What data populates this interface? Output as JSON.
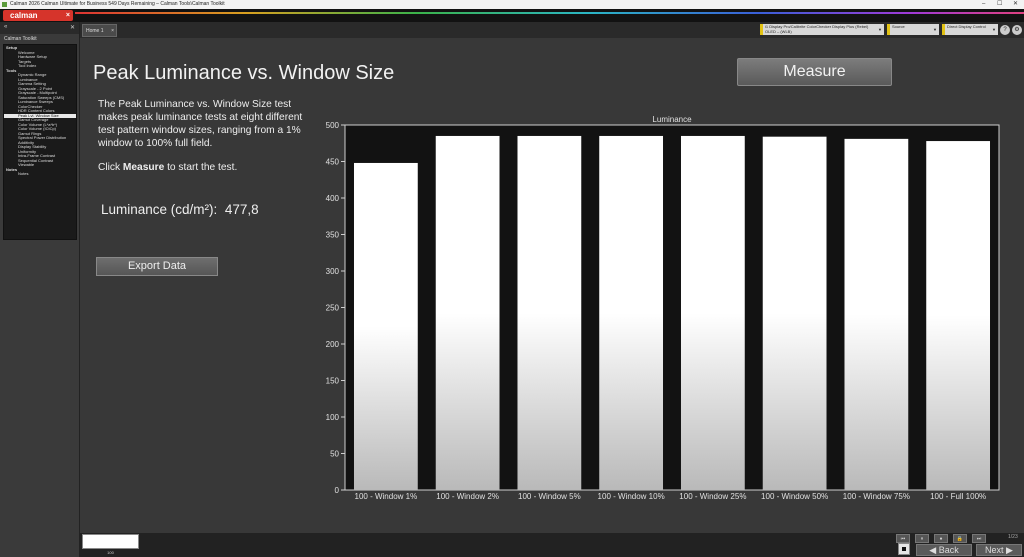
{
  "window": {
    "title": "Calman 2026 Calman Ultimate for Business 549 Days Remaining – Calman Tools\\Calman Toolkit",
    "minimize": "–",
    "maximize": "☐",
    "close": "✕"
  },
  "brand": {
    "logo": "calman",
    "close": "×"
  },
  "sidebar": {
    "title": "Calman Toolkit",
    "collapse": "«",
    "pin": "✕",
    "items": [
      {
        "label": "Setup",
        "kind": "section"
      },
      {
        "label": "Welcome",
        "kind": "leaf"
      },
      {
        "label": "Hardware Setup",
        "kind": "leaf"
      },
      {
        "label": "Targets",
        "kind": "leaf"
      },
      {
        "label": "Tool Index",
        "kind": "leaf"
      },
      {
        "label": "Tools",
        "kind": "section"
      },
      {
        "label": "Dynamic Range",
        "kind": "leaf"
      },
      {
        "label": "Luminance",
        "kind": "leaf"
      },
      {
        "label": "Gamma Setting",
        "kind": "leaf"
      },
      {
        "label": "Grayscale - 2 Point",
        "kind": "leaf"
      },
      {
        "label": "Grayscale - Multipoint",
        "kind": "leaf"
      },
      {
        "label": "Saturation Sweeps (CMS)",
        "kind": "leaf"
      },
      {
        "label": "Luminance Sweeps",
        "kind": "leaf"
      },
      {
        "label": "ColorChecker",
        "kind": "leaf"
      },
      {
        "label": "HDR Content Colors",
        "kind": "leaf"
      },
      {
        "label": "Peak Lvl. Window Size",
        "kind": "leaf",
        "selected": true
      },
      {
        "label": "Gamut Coverage",
        "kind": "leaf"
      },
      {
        "label": "Color Volume (L*a*b*)",
        "kind": "leaf"
      },
      {
        "label": "Color Volume (ICtCp)",
        "kind": "leaf"
      },
      {
        "label": "Gamut Rings",
        "kind": "leaf"
      },
      {
        "label": "Spectral Power Distribution",
        "kind": "leaf"
      },
      {
        "label": "Additivity",
        "kind": "leaf"
      },
      {
        "label": "Display Stability",
        "kind": "leaf"
      },
      {
        "label": "Uniformity",
        "kind": "leaf"
      },
      {
        "label": "Intra-Frame Contrast",
        "kind": "leaf"
      },
      {
        "label": "Sequential Contrast",
        "kind": "leaf"
      },
      {
        "label": "Viewable",
        "kind": "leaf"
      },
      {
        "label": "Notes",
        "kind": "section"
      },
      {
        "label": "Notes",
        "kind": "leaf"
      }
    ]
  },
  "tabs": [
    {
      "label": "Home 1",
      "close": "×"
    }
  ],
  "devices": [
    {
      "line1": "i1 Display Pro/Calibrite ColorChecker Display Plus (Rebel)",
      "line2": "OLED – (WLB)"
    },
    {
      "line1": "Source",
      "line2": ""
    },
    {
      "line1": "Direct Display Control",
      "line2": ""
    }
  ],
  "round_buttons": [
    "?",
    "⚙"
  ],
  "main": {
    "title": "Peak Luminance vs. Window Size",
    "measure_label": "Measure",
    "description": "The Peak Luminance vs. Window Size test makes peak luminance tests at eight different test pattern window sizes, ranging from a 1% window to 100% full field.",
    "click_prefix": "Click ",
    "click_bold": "Measure",
    "click_suffix": " to start the test.",
    "luminance_label": "Luminance (cd/m²):",
    "luminance_value": "477,8",
    "export_label": "Export Data"
  },
  "chart_data": {
    "type": "bar",
    "title": "Luminance",
    "categories": [
      "100 - Window  1%",
      "100 - Window  2%",
      "100 - Window  5%",
      "100 - Window 10%",
      "100 - Window 25%",
      "100 - Window 50%",
      "100 - Window 75%",
      "100 - Full  100%"
    ],
    "values": [
      448,
      485,
      485,
      485,
      485,
      484,
      481,
      478
    ],
    "ylim": [
      0,
      500
    ],
    "yticks": [
      "0",
      "50",
      "100",
      "150",
      "200",
      "250",
      "300",
      "350",
      "400",
      "450",
      "500"
    ],
    "grid": false,
    "colors": {
      "bar_top": "#ffffff",
      "bar_bottom": "#b9b9b9",
      "plot_bg": "#121212",
      "frame": "#cfcfcf"
    }
  },
  "bottom": {
    "swatch_label": "100",
    "back_label": "Back",
    "next_label": "Next",
    "counter": "1/23"
  }
}
